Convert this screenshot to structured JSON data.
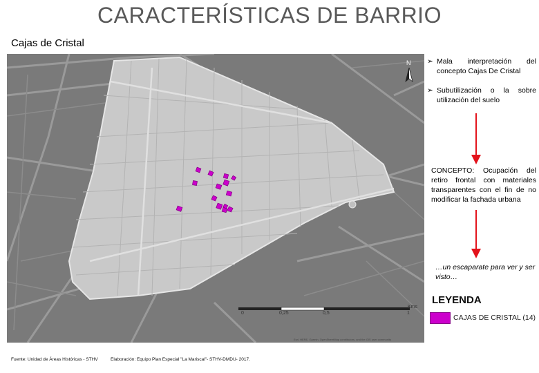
{
  "title": "CARACTERÍSTICAS DE BARRIO",
  "subtitle": "Cajas de Cristal",
  "notes": {
    "bullet_mark": "➢",
    "bullets": [
      "Mala interpretación del concepto Cajas De Cristal",
      "Subutilización o la sobre utilización del suelo"
    ],
    "concept_label": "CONCEPTO:",
    "concept_text": "Ocupación del retiro frontal con materiales transparentes con el fin de no modificar la fachada urbana",
    "tagline": "…un escaparate para ver y ser visto…"
  },
  "map": {
    "north_label": "N",
    "scale": {
      "labels": [
        "0",
        "0,25",
        "0,5",
        "1"
      ],
      "unit": "Kms"
    },
    "credits": "Esri, HERE, Garmin, OpenStreetMap contributors, and the GIS user community"
  },
  "legend": {
    "title": "LEYENDA",
    "item_label": "CAJAS DE CRISTAL",
    "item_count": "(14)",
    "item_color": "#cc00cc"
  },
  "footer": {
    "source": "Fuente: Unidad de Áreas Históricas - STHV",
    "elaboration": "Elaboración: Equipo Plan Especial \"La Mariscal\"- STHV-DMDU- 2017."
  },
  "colors": {
    "arrow": "#e3121b",
    "building": "#cc00cc"
  }
}
